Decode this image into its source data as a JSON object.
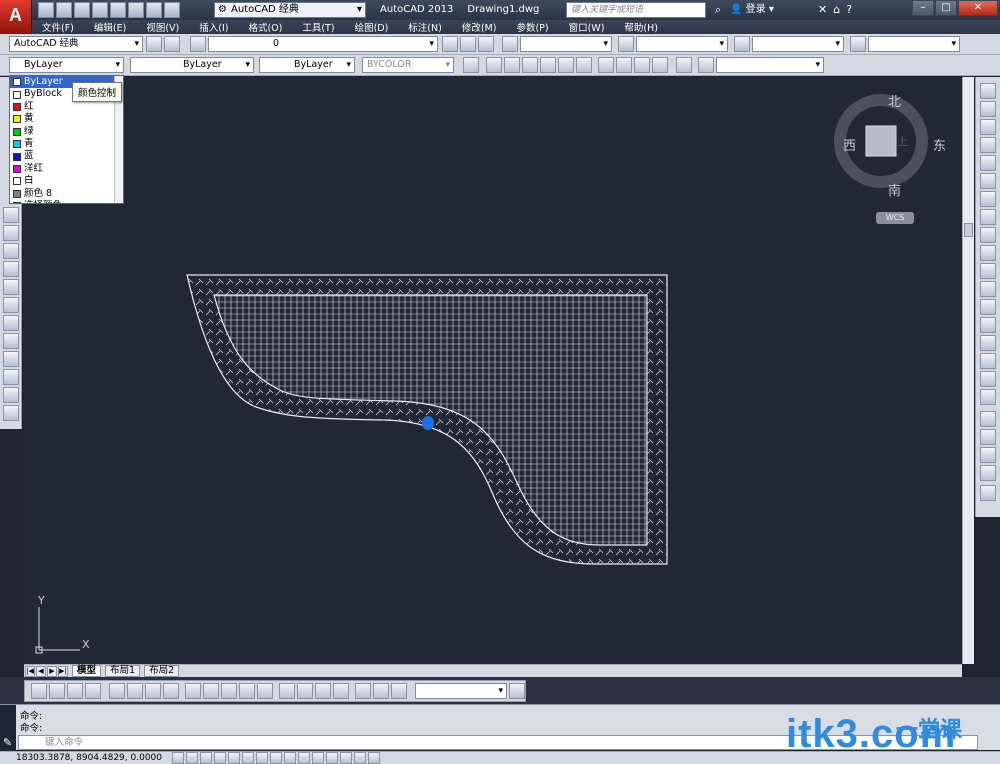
{
  "titlebar": {
    "logo": "A",
    "workspace": "AutoCAD 经典",
    "app_name": "AutoCAD 2013",
    "document": "Drawing1.dwg",
    "search_placeholder": "键入关键字或短语",
    "login_label": "登录",
    "help_label": "?"
  },
  "menu": [
    "文件(F)",
    "编辑(E)",
    "视图(V)",
    "插入(I)",
    "格式(O)",
    "工具(T)",
    "绘图(D)",
    "标注(N)",
    "修改(M)",
    "参数(P)",
    "窗口(W)",
    "帮助(H)"
  ],
  "toolbar1": {
    "workspace_combo": "AutoCAD 经典",
    "layer_combo": "0"
  },
  "toolbar2": {
    "color_combo": "ByLayer",
    "linetype_combo": "ByLayer",
    "lineweight_combo": "ByLayer",
    "plotstyle_combo": "BYCOLOR"
  },
  "color_dropdown": {
    "items": [
      {
        "label": "ByLayer",
        "color": "#ffffff",
        "selected": true
      },
      {
        "label": "ByBlock",
        "color": "#ffffff"
      },
      {
        "label": "红",
        "color": "#e01010"
      },
      {
        "label": "黄",
        "color": "#f0f000"
      },
      {
        "label": "绿",
        "color": "#10c010"
      },
      {
        "label": "青",
        "color": "#10d0d0"
      },
      {
        "label": "蓝",
        "color": "#1010d0"
      },
      {
        "label": "洋红",
        "color": "#d010d0"
      },
      {
        "label": "白",
        "color": "#ffffff"
      },
      {
        "label": "颜色 8",
        "color": "#808080"
      },
      {
        "label": "选择颜色...",
        "color": "#ffffff"
      }
    ],
    "tooltip": "颜色控制"
  },
  "viewcube": {
    "north": "北",
    "south": "南",
    "east": "东",
    "west": "西",
    "top_face": "上",
    "wcs": "WCS"
  },
  "ucs": {
    "x": "X",
    "y": "Y"
  },
  "layout_tabs": [
    "模型",
    "布局1",
    "布局2"
  ],
  "active_tab": "模型",
  "command": {
    "history": [
      "命令:",
      "命令:"
    ],
    "input_placeholder": "键入命令"
  },
  "status": {
    "coordinates": "18303.3878, 8904.4829, 0.0000"
  },
  "watermark": {
    "latin": "itk3.com",
    "chinese": "一堂课"
  }
}
